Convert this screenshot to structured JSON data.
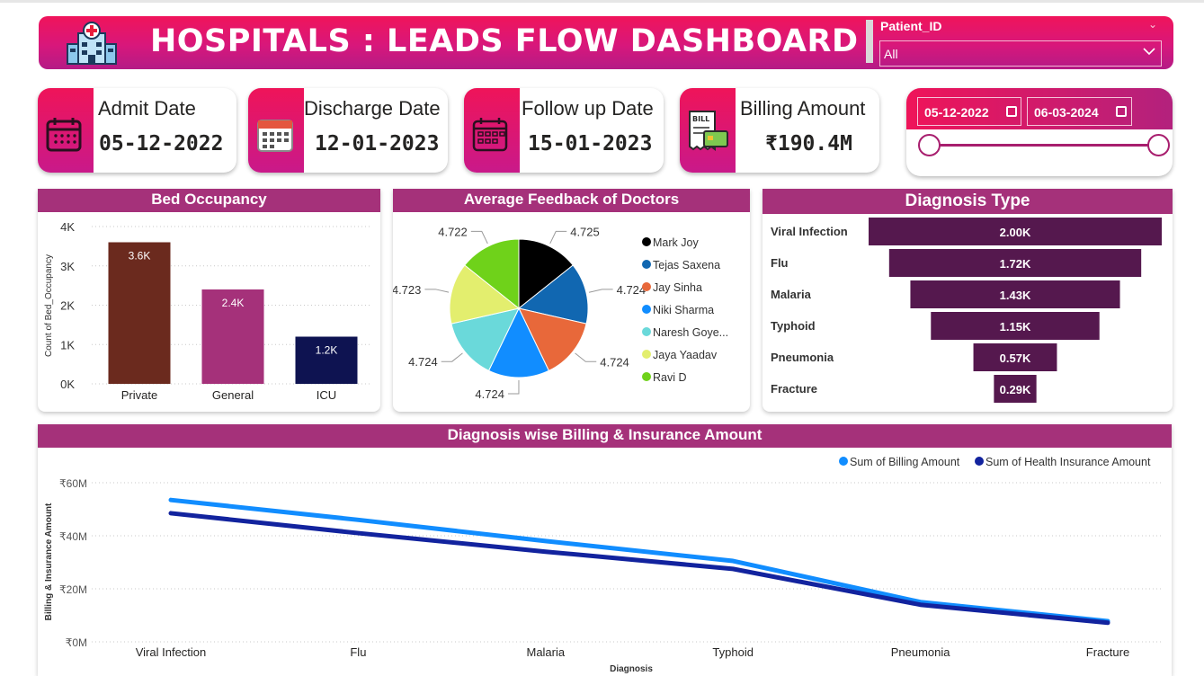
{
  "header": {
    "title": "HOSPITALS : LEADS FLOW DASHBOARD"
  },
  "slicer": {
    "label": "Patient_ID",
    "value": "All"
  },
  "kpis": [
    {
      "label": "Admit Date",
      "value": "05-12-2022",
      "icon": "calendar-icon"
    },
    {
      "label": "Discharge Date",
      "value": "12-01-2023",
      "icon": "calendar-grid-icon"
    },
    {
      "label": "Follow up Date",
      "value": "15-01-2023",
      "icon": "calendar-icon"
    },
    {
      "label": "Billing Amount",
      "value": "₹190.4M",
      "icon": "bill-icon"
    }
  ],
  "date_range": {
    "start": "05-12-2022",
    "end": "06-03-2024"
  },
  "colors": {
    "accent": "#a5317a",
    "header_start": "#f0145a",
    "header_end": "#b41b86"
  },
  "chart_data": [
    {
      "type": "bar",
      "title": "Bed Occupancy",
      "ylabel": "Count of Bed_Occupancy",
      "categories": [
        "Private",
        "General",
        "ICU"
      ],
      "values": [
        3600,
        2400,
        1200
      ],
      "data_labels": [
        "3.6K",
        "2.4K",
        "1.2K"
      ],
      "colors": [
        "#6b2a1e",
        "#a5317a",
        "#0e1351"
      ],
      "ylim": [
        0,
        4000
      ],
      "ytick_values": [
        0,
        1000,
        2000,
        3000,
        4000
      ],
      "yticks": [
        "0K",
        "1K",
        "2K",
        "3K",
        "4K"
      ],
      "grid": true
    },
    {
      "type": "pie",
      "title": "Average Feedback of Doctors",
      "categories": [
        "Mark Joy",
        "Tejas Saxena",
        "Jay Sinha",
        "Niki Sharma",
        "Naresh Goye...",
        "Jaya Yaadav",
        "Ravi D"
      ],
      "values": [
        4.725,
        4.724,
        4.724,
        4.724,
        4.724,
        4.723,
        4.722
      ],
      "data_labels": [
        "4.725",
        "4.724",
        "4.724",
        "4.724",
        "4.724",
        "4.723",
        "4.722"
      ],
      "colors": [
        "#000000",
        "#1167b1",
        "#e8683a",
        "#118dff",
        "#6ad9da",
        "#e3ee6e",
        "#6fd21a"
      ],
      "legend": "right"
    },
    {
      "type": "bar",
      "orientation": "horizontal-funnel",
      "title": "Diagnosis Type",
      "categories": [
        "Viral Infection",
        "Flu",
        "Malaria",
        "Typhoid",
        "Pneumonia",
        "Fracture"
      ],
      "values": [
        2000,
        1720,
        1430,
        1150,
        570,
        290
      ],
      "data_labels": [
        "2.00K",
        "1.72K",
        "1.43K",
        "1.15K",
        "0.57K",
        "0.29K"
      ],
      "color": "#55184e"
    },
    {
      "type": "line",
      "title": "Diagnosis wise Billing & Insurance Amount",
      "xlabel": "Diagnosis",
      "ylabel": "Billing & Insurance Amount",
      "categories": [
        "Viral Infection",
        "Flu",
        "Malaria",
        "Typhoid",
        "Pneumonia",
        "Fracture"
      ],
      "series": [
        {
          "name": "Sum of Billing Amount",
          "color": "#118dff",
          "values": [
            53.5,
            46,
            38,
            30.5,
            15,
            7.8
          ]
        },
        {
          "name": "Sum of Health Insurance Amount",
          "color": "#12239e",
          "values": [
            48.5,
            41,
            34,
            27.5,
            14,
            7.2
          ]
        }
      ],
      "ylim": [
        0,
        60
      ],
      "ytick_values": [
        0,
        20,
        40,
        60
      ],
      "yticks": [
        "₹0M",
        "₹20M",
        "₹40M",
        "₹60M"
      ],
      "legend": "top-right",
      "grid": true
    }
  ]
}
